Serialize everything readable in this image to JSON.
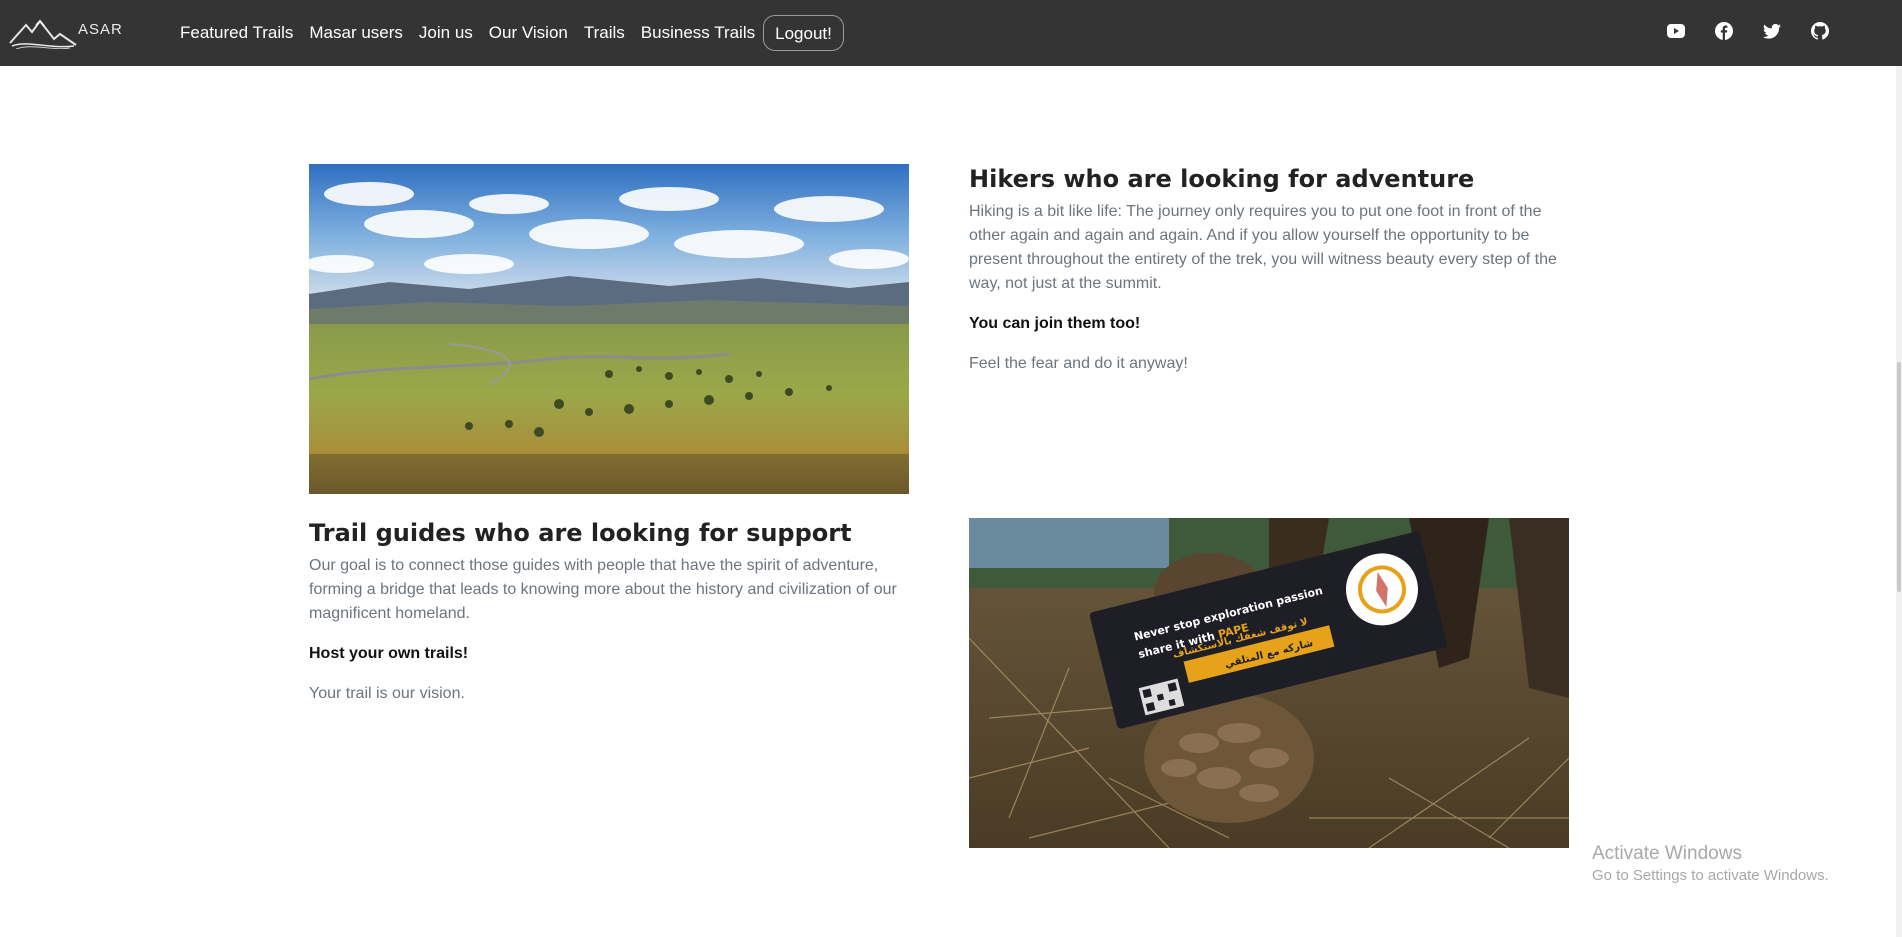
{
  "navbar": {
    "logo_text": "ASAR",
    "links": [
      "Featured Trails",
      "Masar users",
      "Join us",
      "Our Vision",
      "Trails",
      "Business Trails"
    ],
    "logout_label": "Logout!",
    "social": [
      "youtube-icon",
      "facebook-icon",
      "twitter-icon",
      "github-icon"
    ],
    "bg_color": "#343434"
  },
  "section_hikers": {
    "title": "Hikers who are looking for adventure",
    "body": "Hiking is a bit like life: The journey only requires you to put one foot in front of the other again and again and again. And if you allow yourself the opportunity to be present throughout the entirety of the trek, you will witness beauty every step of the way, not just at the summit.",
    "cta": "You can join them too!",
    "tagline": "Feel the fear and do it anyway!"
  },
  "section_guides": {
    "title": "Trail guides who are looking for support",
    "body": "Our goal is to connect those guides with people that have the spirit of adventure, forming a bridge that leads to knowing more about the history and civilization of our magnificent homeland.",
    "cta": "Host your own trails!",
    "tagline": "Your trail is our vision."
  },
  "card_image": {
    "line1": "Never stop exploration passion",
    "line2a": "share it with ",
    "line2b": "PAPE",
    "arabic1": "لا توقف شغفك بالاستكشاف",
    "arabic2": "شاركه مع المتلقي"
  },
  "watermark": {
    "title": "Activate Windows",
    "subtitle": "Go to Settings to activate Windows."
  }
}
